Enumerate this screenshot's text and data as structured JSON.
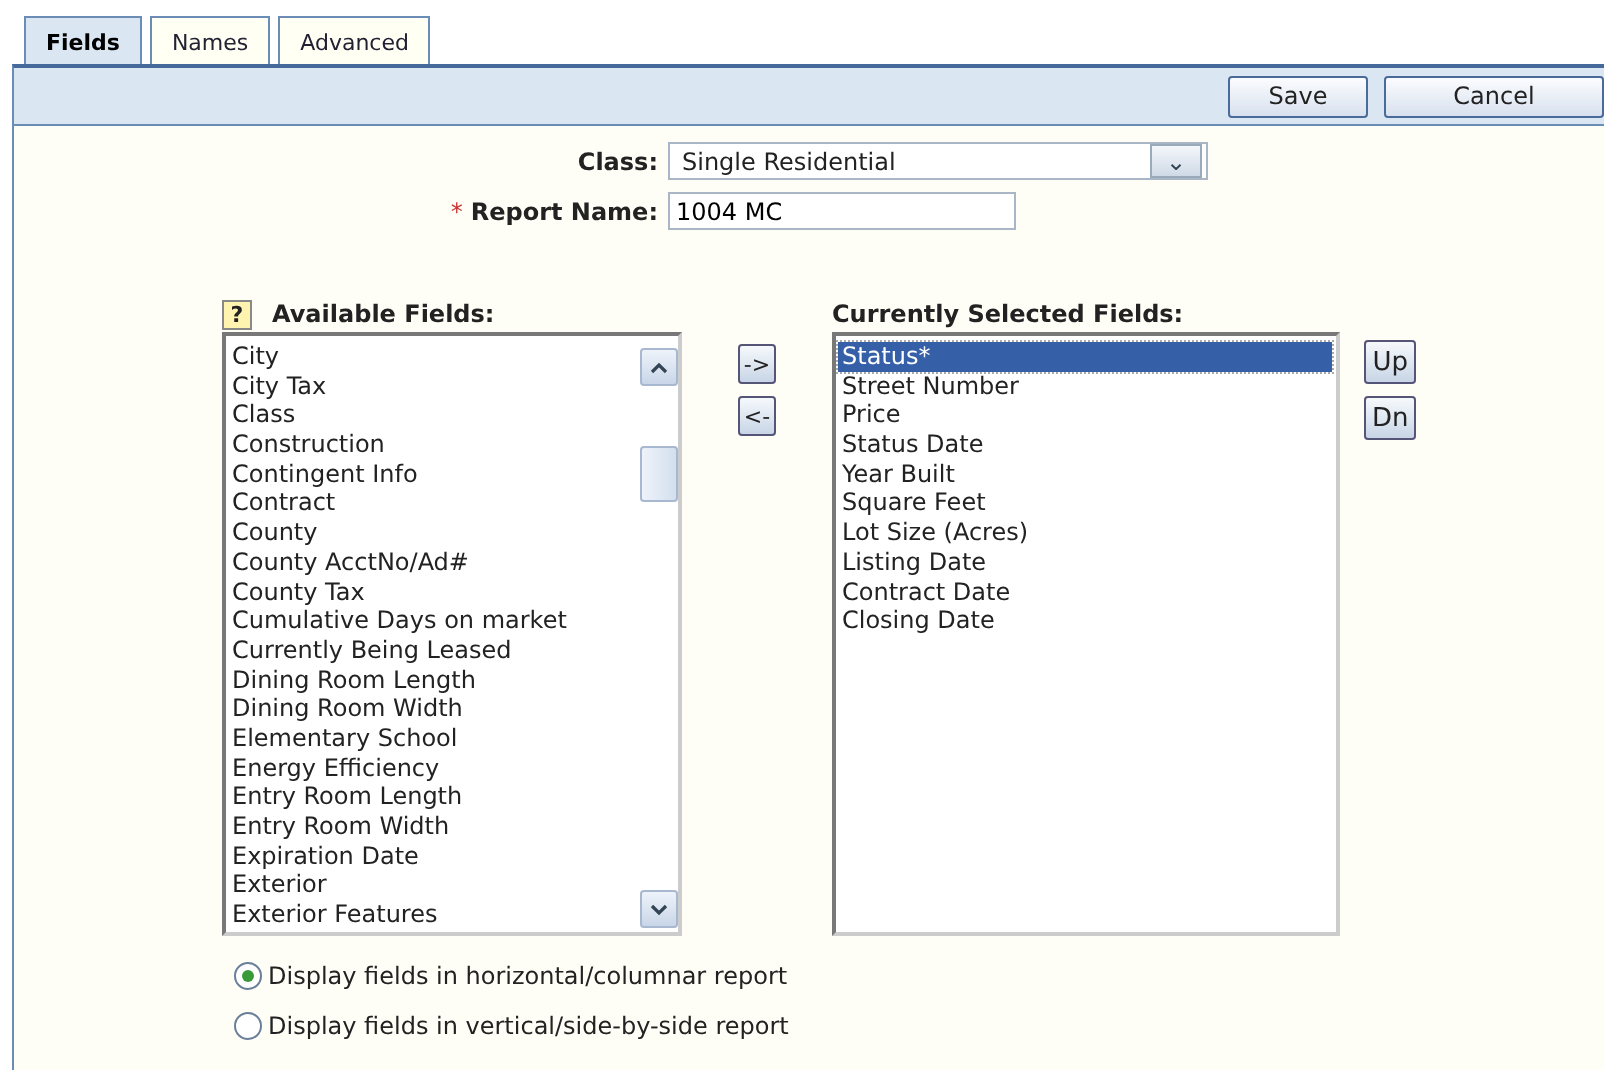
{
  "tabs": [
    {
      "label": "Fields",
      "selected": true
    },
    {
      "label": "Names",
      "selected": false
    },
    {
      "label": "Advanced",
      "selected": false
    }
  ],
  "toolbar": {
    "buttons": [
      "Save",
      "Cancel"
    ]
  },
  "class_field": {
    "label": "Class:",
    "value": "Single Residential",
    "dropdown_icon": "⌄"
  },
  "report_name": {
    "required_mark": "*",
    "label": "Report Name:",
    "value": "1004 MC"
  },
  "available_fields": {
    "help": "?",
    "label": "Available Fields:",
    "items": [
      {
        "label": "City",
        "selected": false
      },
      {
        "label": "City Tax",
        "selected": false
      },
      {
        "label": "Class",
        "selected": false
      },
      {
        "label": "Construction",
        "selected": false
      },
      {
        "label": "Contingent Info",
        "selected": false
      },
      {
        "label": "Contract",
        "selected": false
      },
      {
        "label": "County",
        "selected": false
      },
      {
        "label": "County AcctNo/Ad#",
        "selected": false
      },
      {
        "label": "County Tax",
        "selected": false
      },
      {
        "label": "Cumulative Days on market",
        "selected": false
      },
      {
        "label": "Currently Being Leased",
        "selected": false
      },
      {
        "label": "Dining Room Length",
        "selected": false
      },
      {
        "label": "Dining Room Width",
        "selected": false
      },
      {
        "label": "Elementary School",
        "selected": false
      },
      {
        "label": "Energy Efficiency",
        "selected": false
      },
      {
        "label": "Entry Room Length",
        "selected": false
      },
      {
        "label": "Entry Room Width",
        "selected": false
      },
      {
        "label": "Expiration Date",
        "selected": false
      },
      {
        "label": "Exterior",
        "selected": false
      },
      {
        "label": "Exterior Features",
        "selected": false
      }
    ]
  },
  "move_buttons": [
    "->",
    "<-"
  ],
  "selected_fields": {
    "label": "Currently Selected Fields:",
    "items": [
      {
        "label": "Status*",
        "selected": true
      },
      {
        "label": "Street Number",
        "selected": false
      },
      {
        "label": "Price",
        "selected": false
      },
      {
        "label": "Status Date",
        "selected": false
      },
      {
        "label": "Year Built",
        "selected": false
      },
      {
        "label": "Square Feet",
        "selected": false
      },
      {
        "label": "Lot Size (Acres)",
        "selected": false
      },
      {
        "label": "Listing Date",
        "selected": false
      },
      {
        "label": "Contract Date",
        "selected": false
      },
      {
        "label": "Closing Date",
        "selected": false
      }
    ]
  },
  "order_buttons": [
    "Up",
    "Dn"
  ],
  "display_options": [
    {
      "label": "Display fields in horizontal/columnar report",
      "selected": true
    },
    {
      "label": "Display fields in vertical/side-by-side report",
      "selected": false
    }
  ]
}
